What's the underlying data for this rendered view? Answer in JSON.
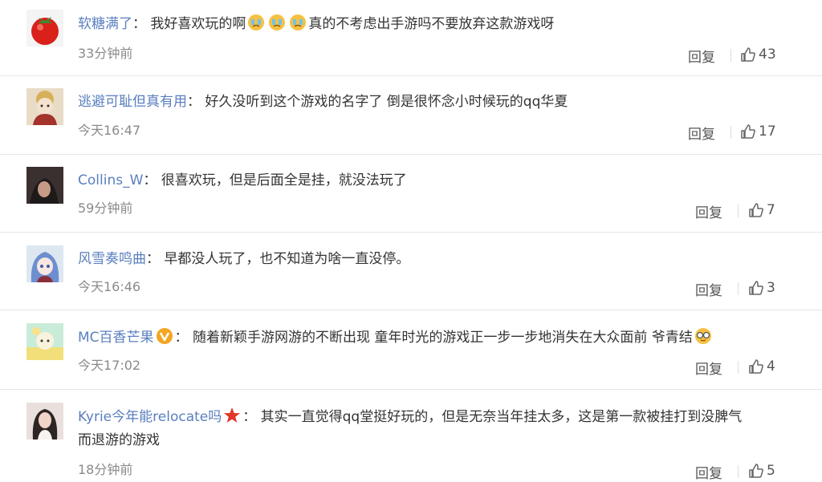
{
  "comments": [
    {
      "user": "软糖满了",
      "colon": "：",
      "text_before": "我好喜欢玩的啊",
      "text_after": "真的不考虑出手游吗不要放弃这款游戏呀",
      "time": "33分钟前",
      "reply": "回复",
      "likes": "43",
      "emojis": [
        "crying-face-icon",
        "crying-face-icon",
        "crying-face-icon"
      ]
    },
    {
      "user": "逃避可耻但真有用",
      "colon": "：",
      "text": "好久没听到这个游戏的名字了 倒是很怀念小时候玩的qq华夏",
      "time": "今天16:47",
      "reply": "回复",
      "likes": "17"
    },
    {
      "user": "Collins_W",
      "colon": "：",
      "text": "很喜欢玩，但是后面全是挂，就没法玩了",
      "time": "59分钟前",
      "reply": "回复",
      "likes": "7"
    },
    {
      "user": "风雪奏鸣曲",
      "colon": "：",
      "text": "早都没人玩了，也不知道为啥一直没停。",
      "time": "今天16:46",
      "reply": "回复",
      "likes": "3"
    },
    {
      "user": "MC百香芒果",
      "colon": "：",
      "text": "随着新颖手游网游的不断出现 童年时光的游戏正一步一步地消失在大众面前 爷青结",
      "time": "今天17:02",
      "reply": "回复",
      "likes": "4",
      "badge": "verified-v-icon",
      "emoji_end": "glasses-face-icon"
    },
    {
      "user": "Kyrie今年能relocate吗",
      "colon": "：",
      "text_line1": "其实一直觉得qq堂挺好玩的，但是无奈当年挂太多，这是第一款被挂打到没脾气",
      "text_line2": "而退游的游戏",
      "time": "18分钟前",
      "reply": "回复",
      "likes": "5",
      "badge": "red-star-icon"
    }
  ]
}
